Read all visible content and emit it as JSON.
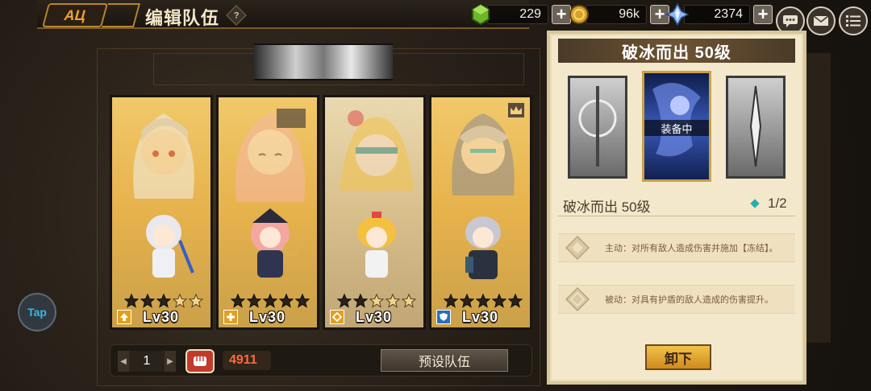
{
  "header": {
    "back_label": "AЦ",
    "title": "编辑队伍",
    "help_glyph": "?"
  },
  "resources": [
    {
      "name": "green-gem",
      "value": "229",
      "color": "#7ac23a"
    },
    {
      "name": "gold-coin",
      "value": "96k",
      "color": "#d9a12a"
    },
    {
      "name": "crystal",
      "value": "2374",
      "color": "#8fb9f0"
    }
  ],
  "plus_glyph": "+",
  "team": {
    "members": [
      {
        "level": "Lv30",
        "stars_filled": 3,
        "stars_total": 5,
        "style": "gold"
      },
      {
        "level": "Lv30",
        "stars_filled": 5,
        "stars_total": 5,
        "style": "gold"
      },
      {
        "level": "Lv30",
        "stars_filled": 2,
        "stars_total": 5,
        "style": "gray"
      },
      {
        "level": "Lv30",
        "stars_filled": 5,
        "stars_total": 5,
        "style": "gold"
      }
    ]
  },
  "bottom": {
    "team_index": "1",
    "power_value": "4911",
    "preset_label": "预设队伍"
  },
  "tap_label": "Tap",
  "panel": {
    "title": "破冰而出 50级",
    "equipped_label": "装备中",
    "weapon_name": "破冰而出 50级",
    "weapon_count": "1/2",
    "skills": [
      {
        "text": "主动：对所有敌人造成伤害并施加【冻结】。"
      },
      {
        "text": "被动：对具有护盾的敌人造成的伤害提升。"
      }
    ],
    "unequip_label": "卸下"
  }
}
